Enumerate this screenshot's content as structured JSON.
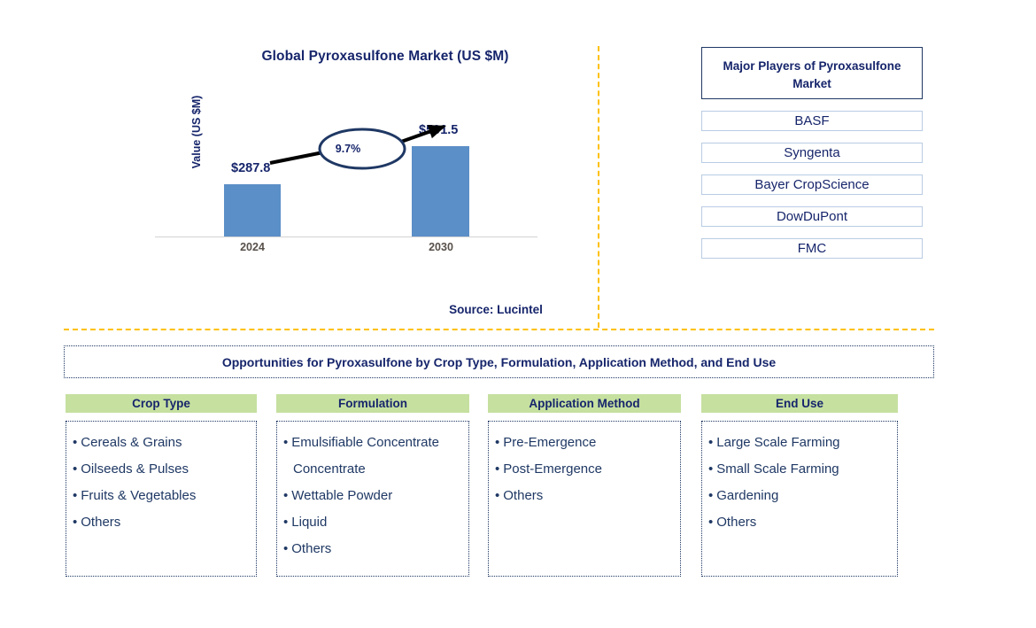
{
  "chart": {
    "title": "Global Pyroxasulfone Market (US $M)",
    "y_axis_label": "Value (US $M)",
    "source": "Source: Lucintel"
  },
  "chart_data": {
    "type": "bar",
    "title": "Global Pyroxasulfone Market (US $M)",
    "categories": [
      "2024",
      "2030"
    ],
    "values": [
      287.8,
      501.5
    ],
    "value_labels": [
      "$287.8",
      "$501.5"
    ],
    "cagr_label": "9.7%",
    "xlabel": "",
    "ylabel": "Value (US $M)",
    "ylim": [
      0,
      560
    ],
    "grid": false,
    "legend": "none",
    "series_color": "#5B8FC7",
    "annotation": "9.7%",
    "source": "Source: Lucintel"
  },
  "players": {
    "header": "Major Players of Pyroxasulfone Market",
    "items": [
      {
        "label": "BASF"
      },
      {
        "label": "Syngenta"
      },
      {
        "label": "Bayer CropScience"
      },
      {
        "label": "DowDuPont"
      },
      {
        "label": "FMC"
      }
    ]
  },
  "opportunities": {
    "banner": "Opportunities for Pyroxasulfone by Crop Type, Formulation, Application Method, and End Use",
    "columns": [
      {
        "header": "Crop Type",
        "items": [
          {
            "text": "Cereals & Grains",
            "bullet": true
          },
          {
            "text": "Oilseeds & Pulses",
            "bullet": true
          },
          {
            "text": "Fruits & Vegetables",
            "bullet": true
          },
          {
            "text": "Others",
            "bullet": true
          }
        ]
      },
      {
        "header": "Formulation",
        "items": [
          {
            "text": "Emulsifiable Concentrate",
            "bullet": true
          },
          {
            "text": "Concentrate",
            "bullet": false
          },
          {
            "text": "Wettable Powder",
            "bullet": true
          },
          {
            "text": "Liquid",
            "bullet": true
          },
          {
            "text": "Others",
            "bullet": true
          }
        ]
      },
      {
        "header": "Application Method",
        "items": [
          {
            "text": "Pre-Emergence",
            "bullet": true
          },
          {
            "text": "Post-Emergence",
            "bullet": true
          },
          {
            "text": "Others",
            "bullet": true
          }
        ]
      },
      {
        "header": "End Use",
        "items": [
          {
            "text": "Large Scale Farming",
            "bullet": true
          },
          {
            "text": "Small Scale Farming",
            "bullet": true
          },
          {
            "text": "Gardening",
            "bullet": true
          },
          {
            "text": "Others",
            "bullet": true
          }
        ]
      }
    ]
  },
  "colors": {
    "bar": "#5B8FC7",
    "navy": "#16256B",
    "green_header": "#C6E0A0",
    "divider": "#FFC000"
  }
}
